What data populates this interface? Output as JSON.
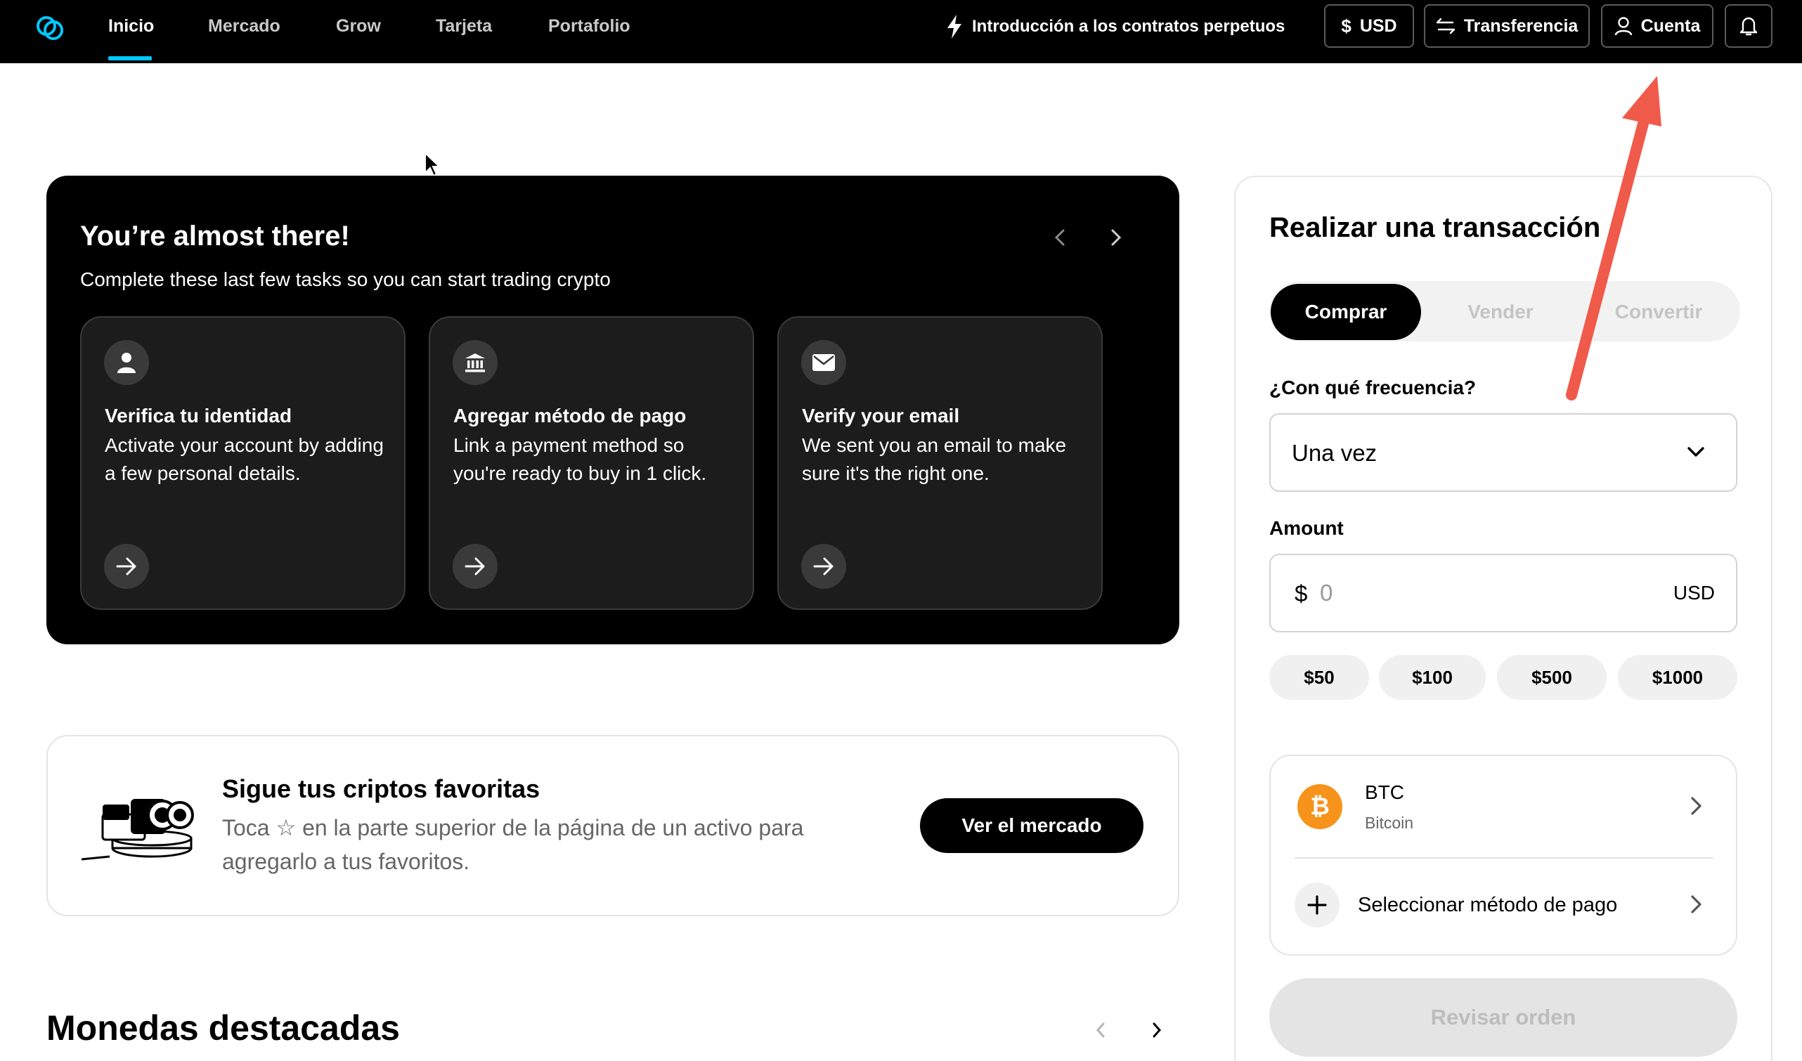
{
  "nav": {
    "links": [
      {
        "label": "Inicio",
        "active": true
      },
      {
        "label": "Mercado",
        "active": false
      },
      {
        "label": "Grow",
        "active": false
      },
      {
        "label": "Tarjeta",
        "active": false
      },
      {
        "label": "Portafolio",
        "active": false
      }
    ],
    "promo": "Introducción a los contratos perpetuos",
    "currency_label": "USD",
    "transfer_label": "Transferencia",
    "account_label": "Cuenta",
    "accent_color": "#00c8ff"
  },
  "onboarding": {
    "title": "You’re almost there!",
    "subtitle": "Complete these last few tasks so you can start trading crypto",
    "tasks": [
      {
        "icon": "person-icon",
        "title": "Verifica tu identidad",
        "description": "Activate your account by adding a few personal details."
      },
      {
        "icon": "bank-icon",
        "title": "Agregar método de pago",
        "description": "Link a payment method so you're ready to buy in 1 click."
      },
      {
        "icon": "envelope-icon",
        "title": "Verify your email",
        "description": "We sent you an email to make sure it's the right one."
      }
    ]
  },
  "favorites": {
    "title": "Sigue tus criptos favoritas",
    "text": "Toca ☆ en la parte superior de la página de un activo para agregarlo a tus favoritos.",
    "button": "Ver el mercado"
  },
  "featured": {
    "title": "Monedas destacadas"
  },
  "transaction": {
    "title": "Realizar una transacción",
    "tabs": [
      {
        "label": "Comprar",
        "active": true
      },
      {
        "label": "Vender",
        "active": false
      },
      {
        "label": "Convertir",
        "active": false
      }
    ],
    "frequency_label": "¿Con qué frecuencia?",
    "frequency_value": "Una vez",
    "amount_label": "Amount",
    "amount_symbol": "$",
    "amount_placeholder": "0",
    "amount_currency": "USD",
    "quick_amounts": [
      "$50",
      "$100",
      "$500",
      "$1000"
    ],
    "asset": {
      "symbol": "BTC",
      "name": "Bitcoin",
      "icon_glyph": "₿",
      "color": "#f7931a"
    },
    "payment_label": "Seleccionar método de pago",
    "review_button": "Revisar orden"
  },
  "annotation": {
    "arrow_color": "#f05a4a"
  }
}
